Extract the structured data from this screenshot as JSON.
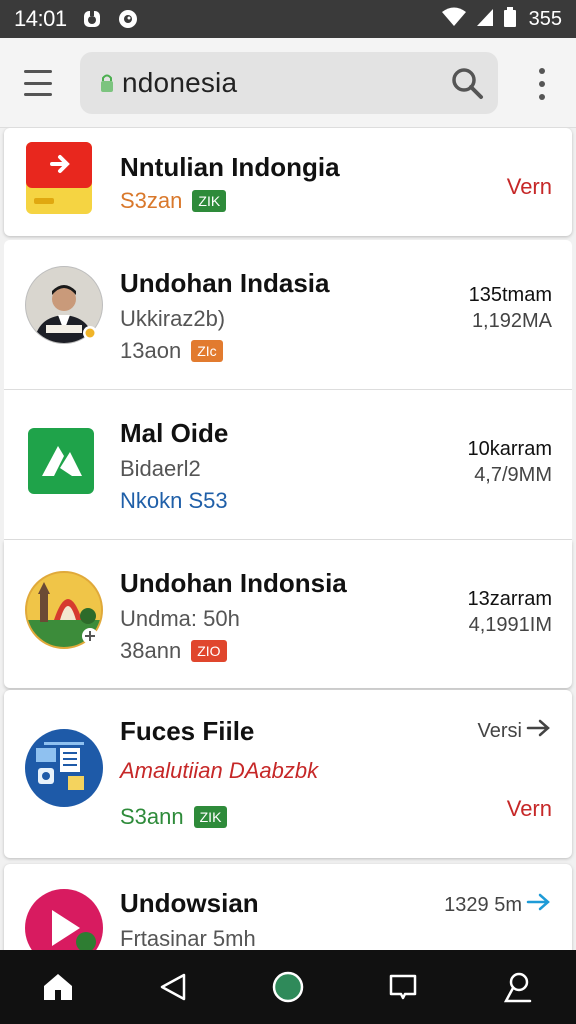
{
  "status_bar": {
    "time": "14:01",
    "battery_text": "355",
    "icons": [
      "notification-app-icon",
      "notification-eye-icon",
      "wifi-icon",
      "signal-icon",
      "battery-icon"
    ]
  },
  "app_bar": {
    "search_value": "ndonesia",
    "icons": [
      "menu-icon",
      "lock-icon",
      "search-icon",
      "more-vert-icon"
    ]
  },
  "items": [
    {
      "title": "Nntulian Indongia",
      "meta_text": "S3zan",
      "badge_text": "ZIK",
      "action_label": "Vern",
      "icon": "red-app-icon",
      "colors": {
        "meta": "#d9782b",
        "badge": "#2e8b3a",
        "action": "#c62828"
      }
    },
    {
      "title": "Undohan Indasia",
      "subtitle": "Ukkiraz2b)",
      "meta_text": "13aon",
      "badge_text": "ZIc",
      "right_top": "135tmam",
      "right_bottom": "1,192MA",
      "icon": "person-avatar-icon",
      "colors": {
        "meta": "#555555",
        "badge": "#e27b2f"
      }
    },
    {
      "title": "Mal Oide",
      "subtitle": "Bidaerl2",
      "meta_text": "Nkokn S53",
      "right_top": "10karram",
      "right_bottom": "4,7/9MM",
      "icon": "green-app-icon",
      "colors": {
        "meta": "#1f5fa8"
      }
    },
    {
      "title": "Undohan Indonsia",
      "subtitle": "Undma: 50h",
      "meta_text": "38ann",
      "badge_text": "ZIO",
      "right_top": "13zarram",
      "right_bottom": "4,1991IM",
      "icon": "landmark-photo-icon",
      "colors": {
        "meta": "#555555",
        "badge": "#e0462d"
      }
    },
    {
      "title": "Fuces Fiile",
      "subtitle": "Amalutiian DAabzbk",
      "meta_text": "S3ann",
      "badge_text": "ZIK",
      "right_top": "Versi",
      "action_label": "Vern",
      "icon": "file-manager-icon",
      "colors": {
        "subtitle": "#c62828",
        "meta": "#2e8b3a",
        "badge": "#2e8b3a",
        "action": "#c62828"
      }
    },
    {
      "title": "Undowsian",
      "subtitle": "Frtasinar 5mh",
      "right_top": "1329 5m",
      "icon": "play-app-icon"
    }
  ],
  "nav_bar": {
    "icons": [
      "home-icon",
      "back-icon",
      "home-circle-icon",
      "recents-icon",
      "assistant-icon"
    ]
  }
}
